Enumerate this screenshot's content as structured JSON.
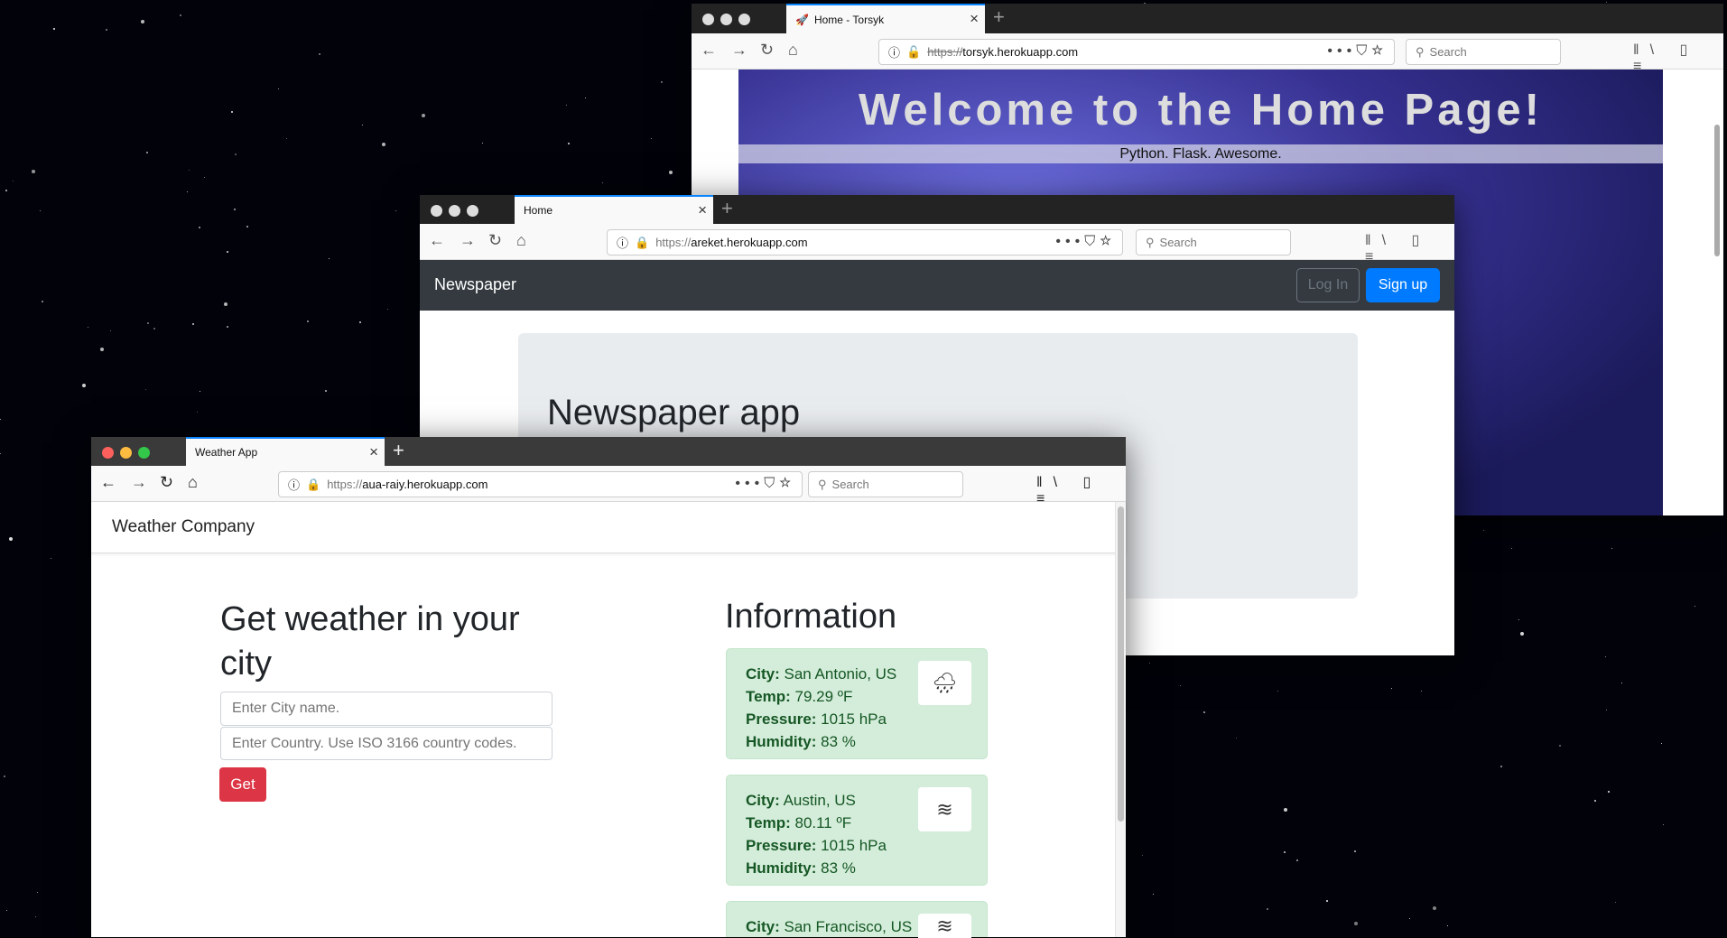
{
  "torsyk": {
    "tab_title": "Home - Torsyk",
    "url_scheme": "https://",
    "url_host": "torsyk.herokuapp.com",
    "search_placeholder": "Search",
    "heading": "Welcome to the Home Page!",
    "subtitle": "Python. Flask. Awesome."
  },
  "newspaper": {
    "tab_title": "Home",
    "url_scheme": "https://",
    "url_host": "areket.herokuapp.com",
    "search_placeholder": "Search",
    "brand": "Newspaper",
    "login": "Log In",
    "signup": "Sign up",
    "jumbotron_title": "Newspaper app"
  },
  "weather": {
    "tab_title": "Weather App",
    "url_scheme": "https://",
    "url_host": "aua-raiy.herokuapp.com",
    "search_placeholder": "Search",
    "brand": "Weather Company",
    "form_title": "Get weather in your city",
    "city_placeholder": "Enter City name.",
    "country_placeholder": "Enter Country. Use ISO 3166 country codes.",
    "get_button": "Get",
    "info_title": "Information",
    "labels": {
      "city": "City:",
      "temp": "Temp:",
      "pressure": "Pressure:",
      "humidity": "Humidity:"
    },
    "cards": [
      {
        "city": "San Antonio, US",
        "temp": "79.29 ºF",
        "pressure": "1015 hPa",
        "humidity": "83 %",
        "icon": "rain-cloud-icon"
      },
      {
        "city": "Austin, US",
        "temp": "80.11 ºF",
        "pressure": "1015 hPa",
        "humidity": "83 %",
        "icon": "mist-icon"
      },
      {
        "city": "San Francisco, US",
        "icon": "mist-icon"
      }
    ]
  }
}
